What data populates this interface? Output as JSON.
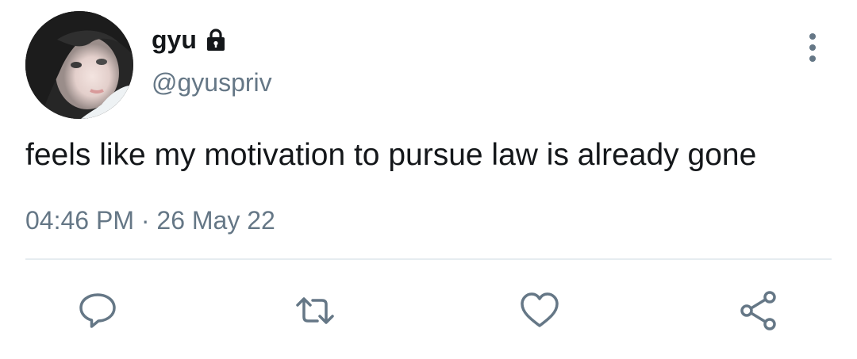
{
  "author": {
    "display_name": "gyu",
    "handle": "@gyuspriv",
    "protected_icon": "lock-icon",
    "avatar": "user-avatar-photo"
  },
  "tweet": {
    "text": "feels like my motivation to pursue law is already gone",
    "time": "04:46 PM",
    "separator": "·",
    "date": "26 May 22"
  },
  "actions": [
    {
      "icon": "reply-icon"
    },
    {
      "icon": "retweet-icon"
    },
    {
      "icon": "like-icon"
    },
    {
      "icon": "share-icon"
    }
  ],
  "menu": {
    "icon": "more-vertical-icon"
  },
  "colors": {
    "text_primary": "#14171a",
    "text_secondary": "#657786",
    "divider": "#e6ecf0",
    "icon": "#657786"
  }
}
